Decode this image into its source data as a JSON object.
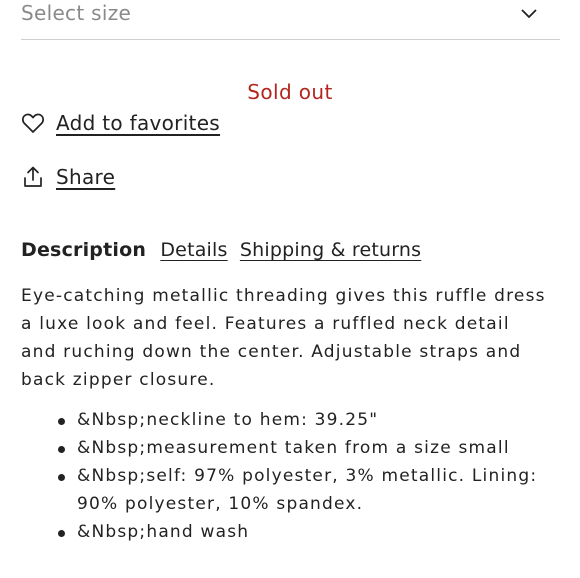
{
  "size_select": {
    "label": "Select size",
    "icon": "chevron-down-icon"
  },
  "status": {
    "text": "Sold out",
    "color": "#b3261e"
  },
  "actions": {
    "favorites_label": "Add to favorites",
    "share_label": "Share"
  },
  "tabs": [
    {
      "label": "Description",
      "active": true
    },
    {
      "label": "Details",
      "active": false
    },
    {
      "label": "Shipping & returns",
      "active": false
    }
  ],
  "description": {
    "text": "Eye-catching metallic threading gives this ruffle dress a luxe look and feel. Features a ruffled neck detail and ruching down the center. Adjustable straps and back zipper closure.",
    "bullets": [
      "&Nbsp;neckline to hem: 39.25\"",
      "&Nbsp;measurement taken from a size small",
      "&Nbsp;self: 97% polyester, 3% metallic. Lining: 90% polyester, 10% spandex.",
      "&Nbsp;hand wash"
    ]
  }
}
